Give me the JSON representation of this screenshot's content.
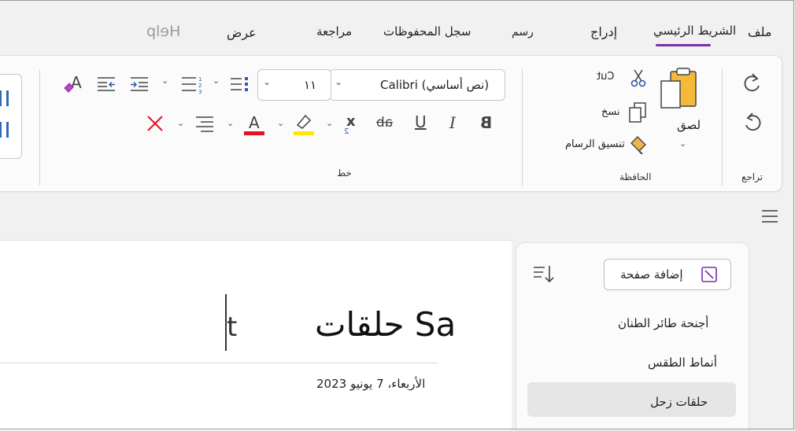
{
  "tabs": [
    {
      "label": "ملف"
    },
    {
      "label": "الشريط الرئيسي"
    },
    {
      "label": "إدراج"
    },
    {
      "label": "رسم"
    },
    {
      "label": "سجل المحفوظات"
    },
    {
      "label": "مراجعة"
    },
    {
      "label": "عرض"
    },
    {
      "label": "Help"
    }
  ],
  "ribbon": {
    "undo_group_label": "تراجع",
    "clipboard": {
      "group_label": "الحافظة",
      "paste_label": "لصق",
      "cut_label": "Cut",
      "copy_label": "نسخ",
      "format_painter_label": "تنسيق الرسام"
    },
    "font": {
      "group_label": "خط",
      "font_name": "Calibri (نص أساسي)",
      "font_size": "١١",
      "bold": "B",
      "italic": "I",
      "underline": "U",
      "strike": "ab",
      "subscript": "x"
    }
  },
  "sidebar": {
    "add_page_label": "إضافة صفحة",
    "pages": [
      {
        "label": "أجنحة طائر الطنان"
      },
      {
        "label": "أنماط الطقس"
      },
      {
        "label": "حلقات زحل"
      }
    ],
    "selected_index": 2
  },
  "page": {
    "title": "حلقات Sa",
    "date": "الأربعاء، 7 يونيو 2023"
  },
  "colors": {
    "accent": "#7b2fa8",
    "font_color": "#e81123",
    "highlight": "#ffe600",
    "format_painter": "#e8a33d"
  }
}
